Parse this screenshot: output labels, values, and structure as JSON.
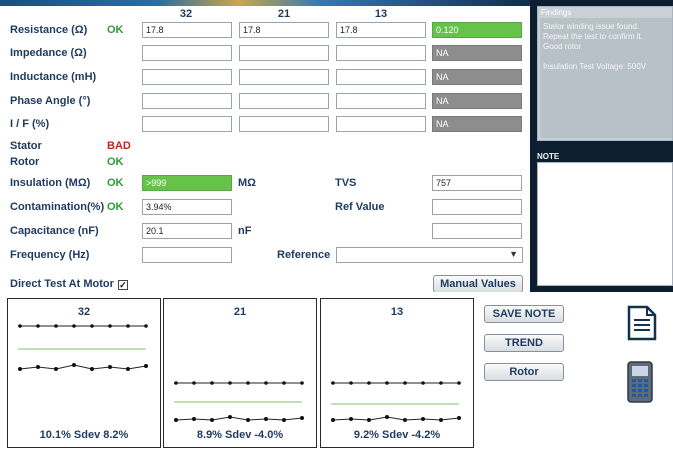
{
  "columns": [
    "32",
    "21",
    "13"
  ],
  "rows": [
    {
      "label": "Resistance (Ω)",
      "status": "OK",
      "values": [
        "17.8",
        "17.8",
        "17.8"
      ],
      "result": "0.120",
      "result_style": "green"
    },
    {
      "label": "Impedance (Ω)",
      "status": "",
      "values": [
        "",
        "",
        ""
      ],
      "result": "NA",
      "result_style": "gray"
    },
    {
      "label": "Inductance (mH)",
      "status": "",
      "values": [
        "",
        "",
        ""
      ],
      "result": "NA",
      "result_style": "gray"
    },
    {
      "label": "Phase Angle (°)",
      "status": "",
      "values": [
        "",
        "",
        ""
      ],
      "result": "NA",
      "result_style": "gray"
    },
    {
      "label": "I / F (%)",
      "status": "",
      "values": [
        "",
        "",
        ""
      ],
      "result": "NA",
      "result_style": "gray"
    }
  ],
  "stator": {
    "label": "Stator",
    "status": "BAD"
  },
  "rotor": {
    "label": "Rotor",
    "status": "OK"
  },
  "insulation": {
    "label": "Insulation (MΩ)",
    "status": "OK",
    "value": ">999",
    "unit": "MΩ",
    "tvs_label": "TVS",
    "tvs_value": "757"
  },
  "contamination": {
    "label": "Contamination(%)",
    "status": "OK",
    "value": "3.94%",
    "ref_label": "Ref Value",
    "ref_value": ""
  },
  "capacitance": {
    "label": "Capacitance (nF)",
    "value": "20.1",
    "unit": "nF",
    "extra_value": ""
  },
  "frequency": {
    "label": "Frequency (Hz)",
    "value": "",
    "reference_label": "Reference",
    "reference_value": ""
  },
  "direct_test": {
    "label": "Direct Test At Motor",
    "checked": true,
    "check_glyph": "✓"
  },
  "manual_values_label": "Manual Values",
  "findings": {
    "title": "Findings",
    "lines": [
      "Stator winding issue found.",
      "Repeat the test to confirm it.",
      "Good rotor",
      "",
      "Insulation Test Voltage: 500V"
    ]
  },
  "note": {
    "title": "NOTE",
    "text": ""
  },
  "buttons": {
    "save_note": "SAVE NOTE",
    "trend": "TREND",
    "rotor": "Rotor"
  },
  "icons": {
    "document": "document-icon",
    "calculator": "calculator-icon"
  },
  "panels": [
    {
      "title": "32",
      "footer": "10.1%   Sdev 8.2%"
    },
    {
      "title": "21",
      "footer": "8.9%   Sdev -4.0%"
    },
    {
      "title": "13",
      "footer": "9.2%   Sdev -4.2%"
    }
  ],
  "colors": {
    "ok": "#2e9a3a",
    "bad": "#c0261e",
    "result_green": "#66c24a",
    "result_gray": "#8d8d8d",
    "text_navy": "#1e3a5f"
  }
}
